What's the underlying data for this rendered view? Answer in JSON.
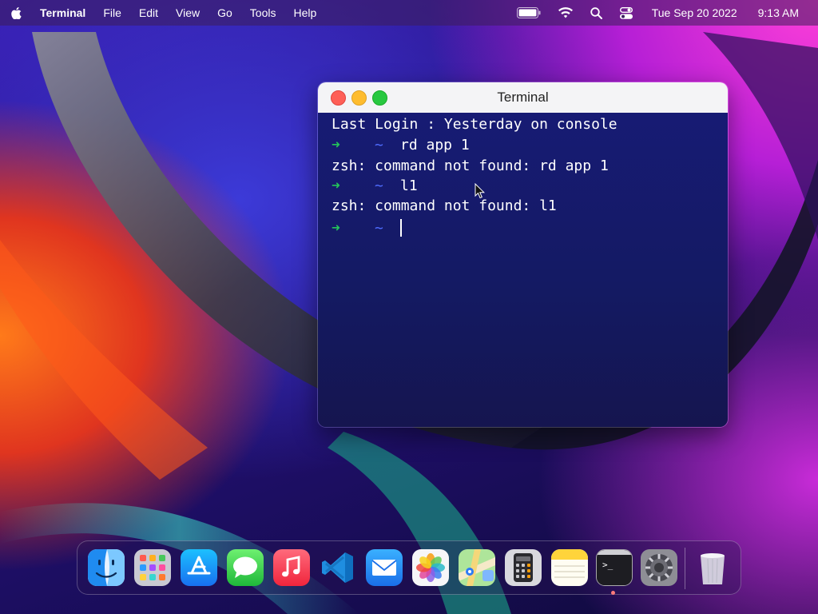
{
  "menubar": {
    "app_name": "Terminal",
    "menus": [
      "File",
      "Edit",
      "View",
      "Go",
      "Tools",
      "Help"
    ],
    "date": "Tue Sep 20 2022",
    "time": "9:13 AM"
  },
  "terminal": {
    "title": "Terminal",
    "login_line": "Last Login : Yesterday on console",
    "prompt_arrow": "➜",
    "prompt_dir": "~",
    "commands": [
      {
        "input": "rd app 1",
        "output": "zsh: command not found: rd app 1"
      },
      {
        "input": "l1",
        "output": "zsh: command not found: l1"
      }
    ]
  },
  "dock": {
    "apps": [
      "finder",
      "launchpad",
      "app-store",
      "messages",
      "music",
      "vscode",
      "mail",
      "photos",
      "maps",
      "calculator",
      "notes",
      "terminal",
      "system-preferences",
      "trash"
    ],
    "running": "terminal",
    "terminal_icon_text": ">_"
  },
  "colors": {
    "prompt_arrow": "#24c45a",
    "prompt_dir": "#4f6cff",
    "terminal_bg": "#171b74"
  }
}
